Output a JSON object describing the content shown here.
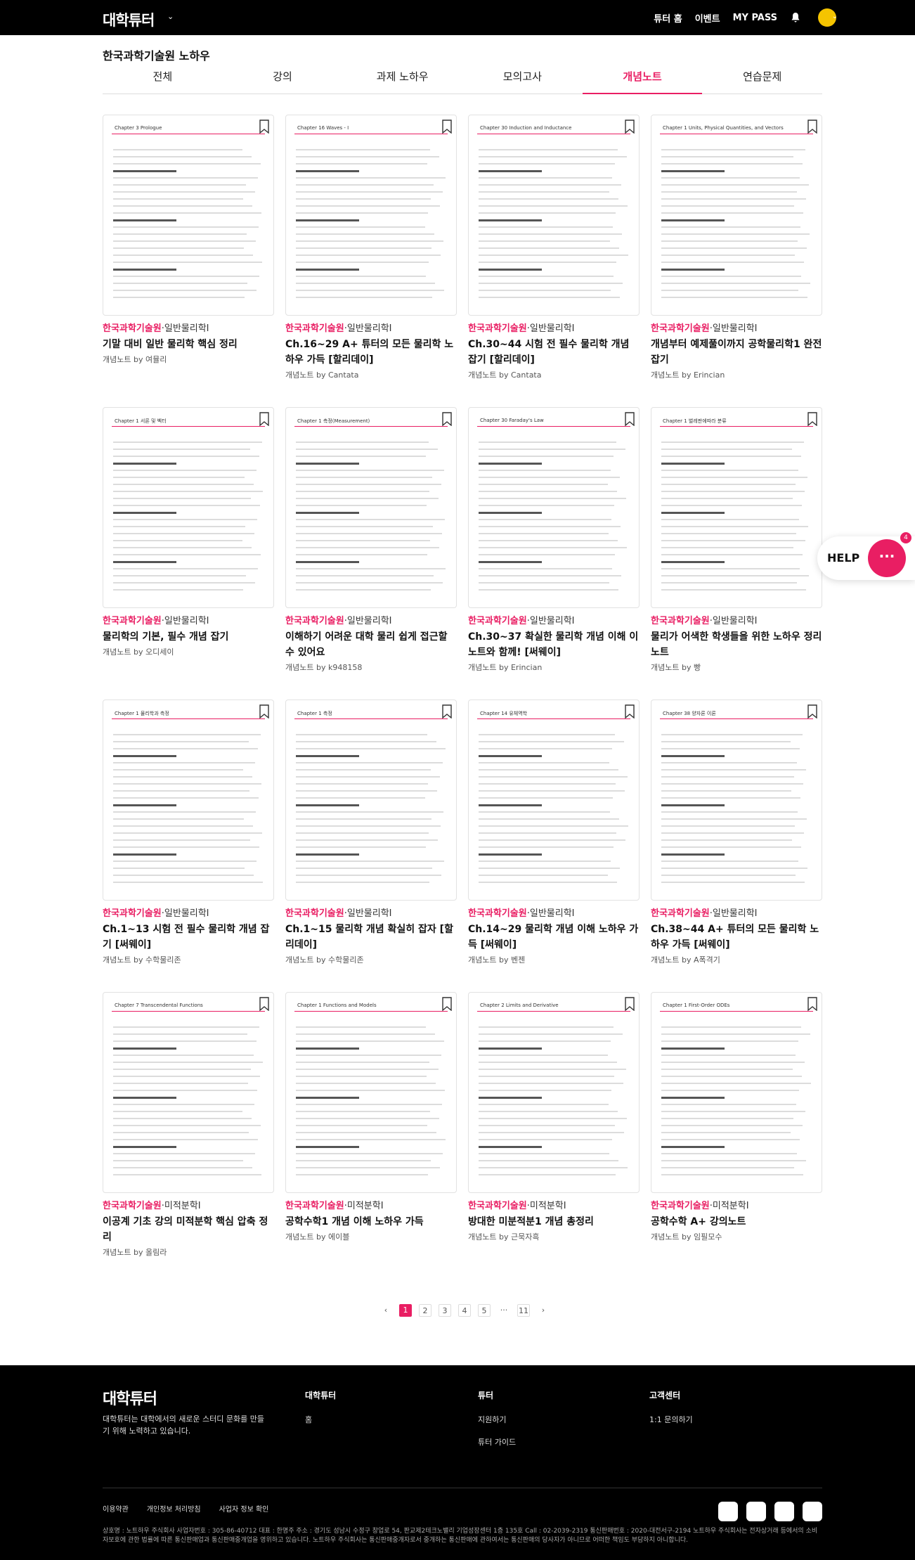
{
  "nav": {
    "logo": "대학튜터",
    "links": [
      "튜터 홈",
      "이벤트",
      "MY PASS"
    ],
    "icons": [
      "bell-icon",
      "avatar",
      "chevron-down-icon"
    ]
  },
  "page": {
    "title": "한국과학기술원 노하우",
    "tabs": [
      "전체",
      "강의",
      "과제 노하우",
      "모의고사",
      "개념노트",
      "연습문제"
    ],
    "active_tab": "개념노트"
  },
  "cards": [
    {
      "chapter": "Chapter 3 Prologue",
      "org": "한국과학기술원",
      "subject": "일반물리학I",
      "title": "기말 대비 일반 물리학 핵심 정리",
      "type": "개념노트",
      "author": "여뮬리"
    },
    {
      "chapter": "Chapter 16 Waves - I",
      "org": "한국과학기술원",
      "subject": "일반물리학I",
      "title": "Ch.16~29 A+ 튜터의 모든 물리학 노하우 가득 [할리데이]",
      "type": "개념노트",
      "author": "Cantata"
    },
    {
      "chapter": "Chapter 30 Induction and Inductance",
      "org": "한국과학기술원",
      "subject": "일반물리학I",
      "title": "Ch.30~44 시험 전 필수 물리학 개념 잡기 [할리데이]",
      "type": "개념노트",
      "author": "Cantata"
    },
    {
      "chapter": "Chapter 1 Units, Physical Quantities, and Vectors",
      "org": "한국과학기술원",
      "subject": "일반물리학I",
      "title": "개념부터 예제풀이까지 공학물리학1 완전 잡기",
      "type": "개념노트",
      "author": "Erincian"
    },
    {
      "chapter": "Chapter 1 서론 및 벡터",
      "org": "한국과학기술원",
      "subject": "일반물리학I",
      "title": "물리학의 기본, 필수 개념 잡기",
      "type": "개념노트",
      "author": "오디세이"
    },
    {
      "chapter": "Chapter 1 측정(Measurement)",
      "org": "한국과학기술원",
      "subject": "일반물리학I",
      "title": "이해하기 어려운 대학 물리 쉽게 접근할 수 있어요",
      "type": "개념노트",
      "author": "k948158"
    },
    {
      "chapter": "Chapter 30 Faraday's Law",
      "org": "한국과학기술원",
      "subject": "일반물리학I",
      "title": "Ch.30~37 확실한 물리학 개념 이해 이노트와 함께! [써웨이]",
      "type": "개념노트",
      "author": "Erincian"
    },
    {
      "chapter": "Chapter 1 벌레판에따라 분류",
      "org": "한국과학기술원",
      "subject": "일반물리학I",
      "title": "물리가 어색한 학생들을 위한 노하우 정리노트",
      "type": "개념노트",
      "author": "빵"
    },
    {
      "chapter": "Chapter 1 물리학과 측정",
      "org": "한국과학기술원",
      "subject": "일반물리학I",
      "title": "Ch.1~13 시험 전 필수 물리학 개념 잡기 [써웨이]",
      "type": "개념노트",
      "author": "수학물리존"
    },
    {
      "chapter": "Chapter 1 측정",
      "org": "한국과학기술원",
      "subject": "일반물리학I",
      "title": "Ch.1~15 물리학 개념 확실히 잡자 [할리데이]",
      "type": "개념노트",
      "author": "수학물리존"
    },
    {
      "chapter": "Chapter 14 유체역학",
      "org": "한국과학기술원",
      "subject": "일반물리학I",
      "title": "Ch.14~29 물리학 개념 이해 노하우 가득 [써웨이]",
      "type": "개념노트",
      "author": "벤젠"
    },
    {
      "chapter": "Chapter 38 양자론 이론",
      "org": "한국과학기술원",
      "subject": "일반물리학I",
      "title": "Ch.38~44 A+ 튜터의 모든 물리학 노하우 가득 [써웨이]",
      "type": "개념노트",
      "author": "A폭격기"
    },
    {
      "chapter": "Chapter 7 Transcendental Functions",
      "org": "한국과학기술원",
      "subject": "미적분학I",
      "title": "이공계 기초 강의 미적분학 핵심 압축 정리",
      "type": "개념노트",
      "author": "올림라"
    },
    {
      "chapter": "Chapter 1 Functions and Models",
      "org": "한국과학기술원",
      "subject": "미적분학I",
      "title": "공학수학1 개념 이해 노하우 가득",
      "type": "개념노트",
      "author": "에이블"
    },
    {
      "chapter": "Chapter 2 Limits and Derivative",
      "org": "한국과학기술원",
      "subject": "미적분학I",
      "title": "방대한 미분적분1 개념 총정리",
      "type": "개념노트",
      "author": "근묵자흑"
    },
    {
      "chapter": "Chapter 1 First-Order ODEs",
      "org": "한국과학기술원",
      "subject": "미적분학I",
      "title": "공학수학 A+ 강의노트",
      "type": "개념노트",
      "author": "임필모수"
    }
  ],
  "pagination": {
    "prev": "‹",
    "pages": [
      "1",
      "2",
      "3",
      "4",
      "5"
    ],
    "current": "1",
    "ellipsis": "···",
    "last": "11",
    "next": "›"
  },
  "help": {
    "label": "HELP",
    "badge": "4"
  },
  "footer": {
    "logo": "대학튜터",
    "desc": "대학튜터는 대학에서의 새로운 스터디 문화를 만들기 위해 노력하고 있습니다.",
    "cols": [
      {
        "title": "대학튜터",
        "items": [
          "홈"
        ]
      },
      {
        "title": "튜터",
        "items": [
          "지원하기",
          "튜터 가이드"
        ]
      },
      {
        "title": "고객센터",
        "items": [
          "1:1 문의하기"
        ]
      }
    ],
    "links": [
      "이용약관",
      "개인정보 처리방침",
      "사업자 정보 확인"
    ],
    "social": [
      "kakaotalk-icon",
      "instagram-icon",
      "blog-icon",
      "facebook-icon"
    ],
    "copyright": "상호명 : 노트하우 주식회사 사업자번호 : 305-86-40712 대표 : 한명주 주소 : 경기도 성남시 수정구 창업로 54, 판교제2테크노밸리 기업성장센터 1층 135호 Call : 02-2039-2319 통신판매번호 : 2020-대전서구-2194 노트하우 주식회사는 전자상거래 등에서의 소비자보호에 관한 법률에 따른 통신판매업과 통신판매중개업을 영위하고 있습니다. 노트하우 주식회사는 통신판매중개자로서 중개하는 통신판매에 관하여서는 통신판매의 당사자가 아니므로 어떠한 책임도 부담하지 아니합니다."
  }
}
